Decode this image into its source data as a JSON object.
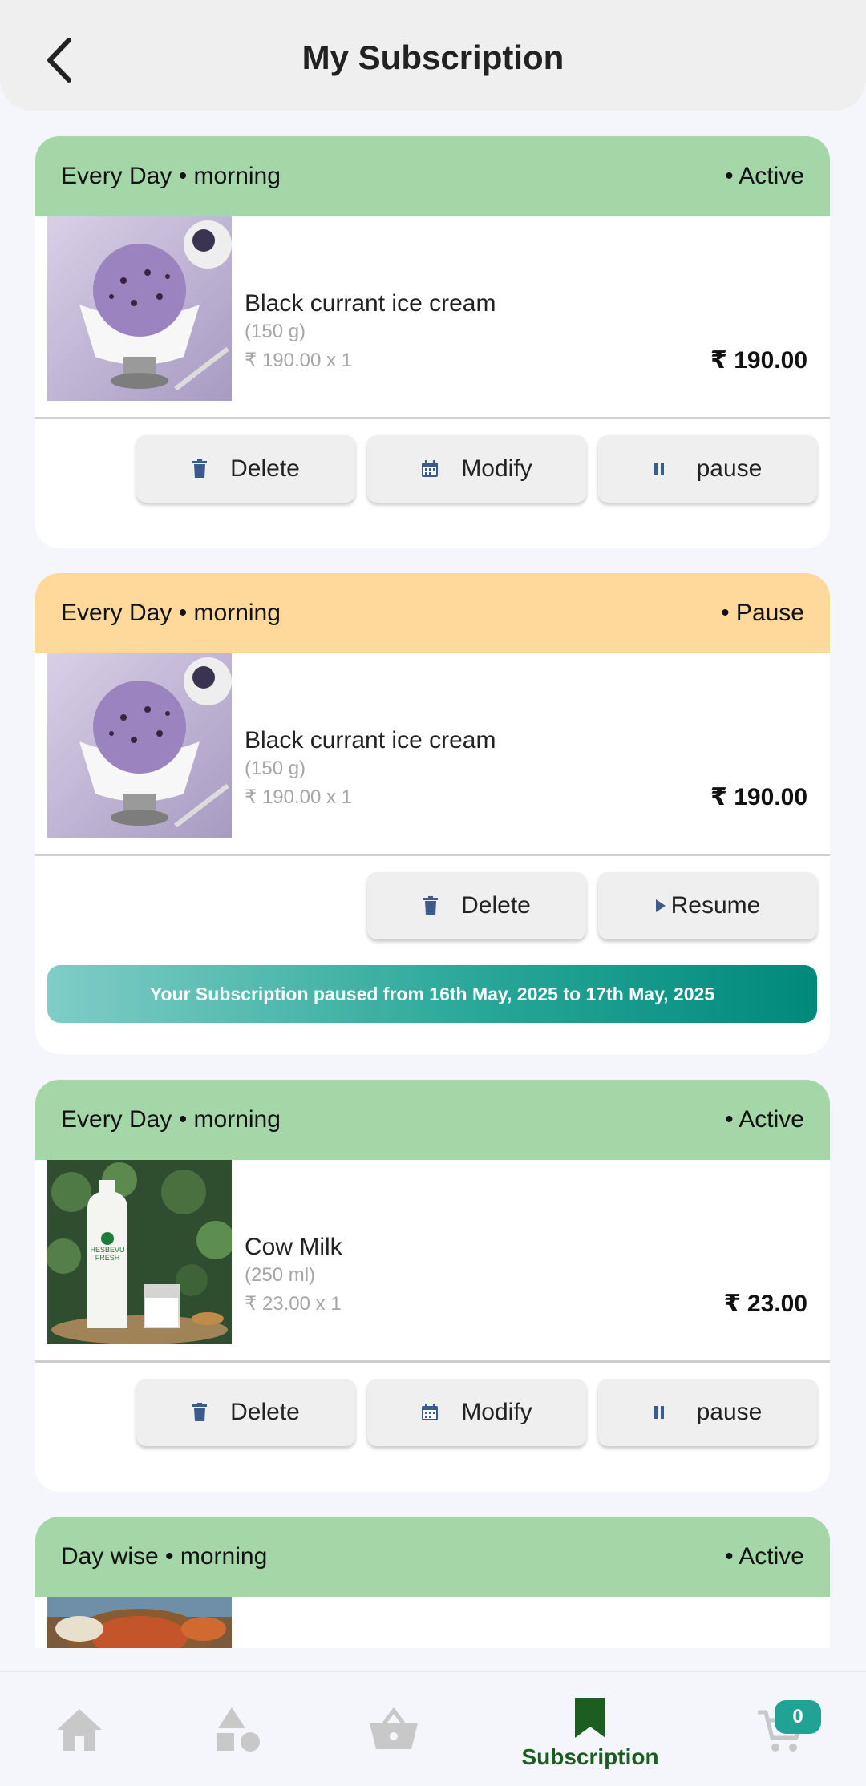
{
  "header": {
    "title": "My Subscription"
  },
  "subscriptions": [
    {
      "schedule": "Every Day • morning",
      "status": "• Active",
      "item": {
        "name": "Black currant ice cream",
        "qty": "(150 g)",
        "unit": "₹ 190.00 x 1",
        "price": "₹ 190.00"
      },
      "actions": {
        "delete": "Delete",
        "modify": "Modify",
        "pause": "pause"
      }
    },
    {
      "schedule": "Every Day • morning",
      "status": "• Pause",
      "item": {
        "name": "Black currant ice cream",
        "qty": "(150 g)",
        "unit": "₹ 190.00 x 1",
        "price": "₹ 190.00"
      },
      "actions": {
        "delete": "Delete",
        "resume": "Resume"
      },
      "banner": "Your Subscription paused from 16th May, 2025 to 17th May, 2025"
    },
    {
      "schedule": "Every Day • morning",
      "status": "• Active",
      "item": {
        "name": "Cow Milk",
        "qty": "(250 ml)",
        "unit": "₹ 23.00 x 1",
        "price": "₹ 23.00"
      },
      "actions": {
        "delete": "Delete",
        "modify": "Modify",
        "pause": "pause"
      }
    },
    {
      "schedule": "Day wise • morning",
      "status": "• Active"
    }
  ],
  "bottom_nav": {
    "items": [
      {
        "icon": "home-icon"
      },
      {
        "icon": "categories-icon"
      },
      {
        "icon": "basket-icon"
      },
      {
        "icon": "bookmark-icon",
        "label": "Subscription",
        "active": true
      },
      {
        "icon": "cart-icon"
      }
    ],
    "cart_count": "0"
  },
  "colors": {
    "active_header": "#a5d6a7",
    "pause_header": "#ffd89c",
    "accent_green": "#1b5e20",
    "icon_blue": "#3b5b8c",
    "banner_teal": "#00897b"
  }
}
